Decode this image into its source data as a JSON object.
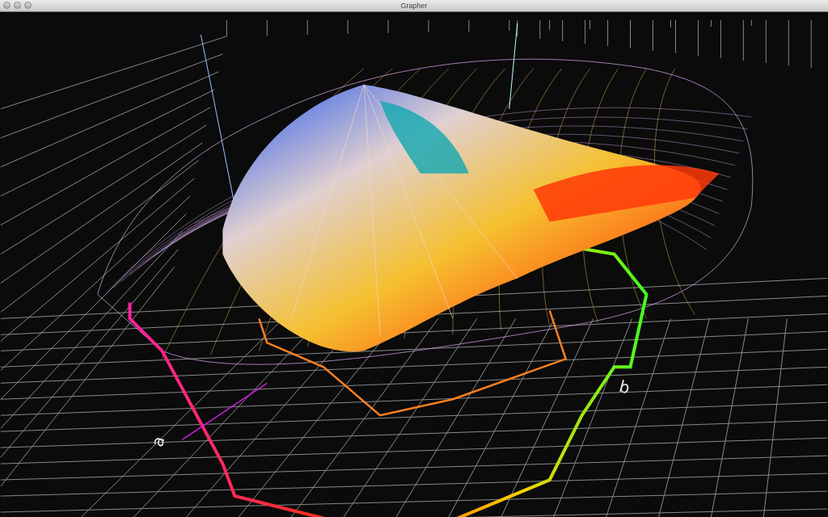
{
  "window": {
    "title": "Grapher"
  },
  "plot": {
    "axis_labels": [
      {
        "text": "a",
        "kind": "a"
      },
      {
        "text": "b",
        "kind": "b"
      }
    ]
  }
}
